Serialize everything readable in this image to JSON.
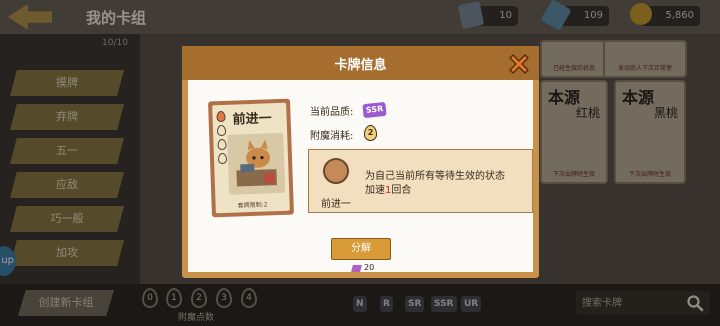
{
  "header": {
    "title": "我的卡组",
    "deck_count": "10/10"
  },
  "resources": [
    "10",
    "109",
    "5,860"
  ],
  "sidebar": {
    "items": [
      "摸牌",
      "弃牌",
      "五一",
      "应敌",
      "巧一般",
      "加攻"
    ]
  },
  "up_badge": "up",
  "grid_cards": [
    {
      "title": "",
      "subtitle": "",
      "tag": "已经生效的状态"
    },
    {
      "title": "",
      "subtitle": "",
      "tag": "发动后人下次正常使"
    },
    {
      "title": "本源",
      "subtitle": "红桃",
      "tag": "下次出牌时生效"
    },
    {
      "title": "本源",
      "subtitle": "黑桃",
      "tag": "下次出牌时生效"
    }
  ],
  "bottom": {
    "create_deck": "创建新卡组",
    "enchant_points": [
      "0",
      "1",
      "2",
      "3",
      "4"
    ],
    "enchant_points_label": "附魔点数",
    "rarity_filters": [
      "N",
      "R",
      "SR",
      "SSR",
      "UR"
    ],
    "search_placeholder": "搜索卡牌"
  },
  "modal": {
    "title": "卡牌信息",
    "card": {
      "name": "前进一",
      "limit_text": "套牌限制:2",
      "drops_filled": 1,
      "drops_total": 4
    },
    "quality_label": "当前品质:",
    "quality_value": "SSR",
    "enchant_cost_label": "附魔消耗:",
    "enchant_cost_value": "2",
    "effect": {
      "line1": "为自己当前所有等待生效的状态",
      "line2_prefix": "加速",
      "line2_num": "1",
      "line2_suffix": "回合",
      "name": "前进一"
    },
    "decompose_label": "分解",
    "decompose_gain": "20"
  },
  "colors": {
    "modal_frame": "#c8924a",
    "modal_header": "#a66e2e",
    "close_x": "#e07a2a",
    "ssr": "#9a5ad0",
    "highlight": "#c02a1a"
  }
}
